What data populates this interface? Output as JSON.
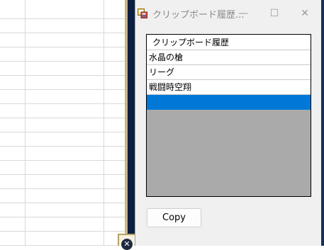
{
  "window": {
    "title": "クリップボード履歴..."
  },
  "title_controls": {
    "minimize": "—",
    "maximize": "☐",
    "close": "✕"
  },
  "list": {
    "header": "クリップボード履歴",
    "items": [
      "水晶の槍",
      "リーグ",
      "戦闘時空翔",
      ""
    ],
    "selected_index": 3
  },
  "buttons": {
    "copy": "Copy"
  },
  "background": {
    "close_glyph": "✕"
  },
  "colors": {
    "selection": "#0078d7",
    "list_empty_area": "#aaaaaa",
    "window_bg": "#f0f0f0"
  }
}
